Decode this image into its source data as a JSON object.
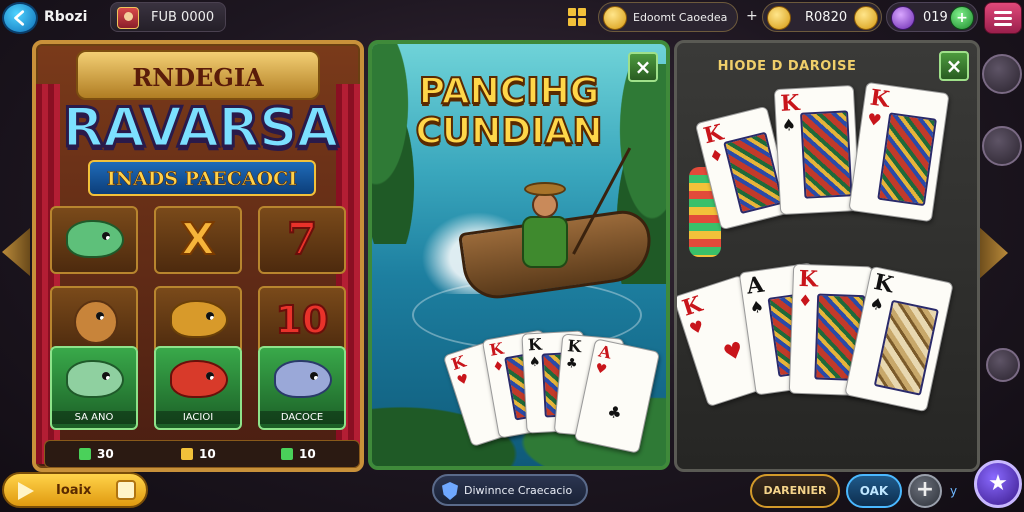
{
  "topbar": {
    "player_name": "Rbozi",
    "player_id": "FUB 0000",
    "coin_text": "Edoomt Caoedea",
    "plus_mark": "+",
    "gold_value": "R0820",
    "gem_value": "019",
    "gem_add": "+"
  },
  "slot_game": {
    "header_title": "RNDEGIA",
    "logo": "RAVARSA",
    "subtitle": "INADS PAECAOCI",
    "symbols": {
      "x": "X",
      "seven": "7",
      "ten": "10"
    },
    "cell_labels": [
      "SA ANO",
      "IACIOI",
      "DACOCE"
    ],
    "wins": [
      {
        "label": "30",
        "color": "#4ad15a"
      },
      {
        "label": "10",
        "color": "#f2c13a"
      },
      {
        "label": "10",
        "color": "#4ad15a"
      }
    ]
  },
  "fishing_game": {
    "title": "PANCIHG CUNDIAN",
    "close": "×"
  },
  "card_game": {
    "title": "HIODE D DAROISE",
    "close": "×"
  },
  "bottom_bar": {
    "play_label": "Ioaix",
    "info_text": "Diwinnce Craecacio",
    "secondary_label": "DARENIER",
    "ok_label": "OAK",
    "plus_label": "+",
    "tiny_mark": "y"
  },
  "cards": {
    "fishing": [
      {
        "rank": "K",
        "suit": "♥",
        "color": "red"
      },
      {
        "rank": "K",
        "suit": "♦",
        "color": "red"
      },
      {
        "rank": "K",
        "suit": "♠",
        "color": "black"
      },
      {
        "rank": "K",
        "suit": "♣",
        "color": "black"
      },
      {
        "rank": "A",
        "suit": "♥",
        "color": "red"
      }
    ],
    "top_row": [
      {
        "rank": "K",
        "suit": "♦",
        "color": "red"
      },
      {
        "rank": "K",
        "suit": "♠",
        "color": "black"
      },
      {
        "rank": "K",
        "suit": "♥",
        "color": "red"
      }
    ],
    "bottom_row": [
      {
        "rank": "K",
        "suit": "♥",
        "color": "red"
      },
      {
        "rank": "A",
        "suit": "♠",
        "color": "black"
      },
      {
        "rank": "K",
        "suit": "♦",
        "color": "red"
      },
      {
        "rank": "K",
        "suit": "♠",
        "color": "black"
      }
    ]
  },
  "colors": {
    "accent_gold": "#f2c13a",
    "panel_green": "#3f8a3a",
    "card_red": "#c8151b"
  }
}
